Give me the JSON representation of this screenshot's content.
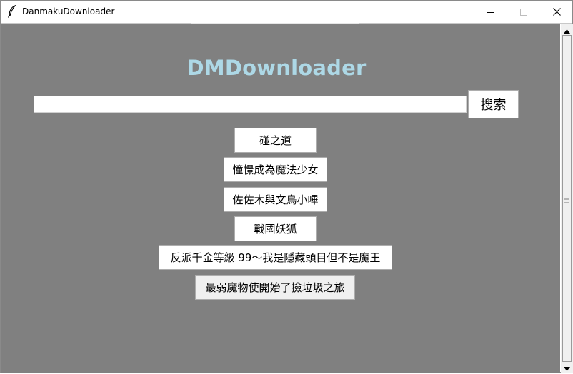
{
  "window": {
    "title": "DanmakuDownloader",
    "icons": [
      "feather-icon",
      "minimize-icon",
      "maximize-icon",
      "close-icon"
    ]
  },
  "main": {
    "heading": "DMDownloader",
    "heading_color": "#add8e6",
    "background_color": "#808080",
    "search": {
      "value": "",
      "placeholder": "",
      "button_label": "搜索"
    },
    "results": [
      {
        "label": "碰之道"
      },
      {
        "label": "憧憬成為魔法少女"
      },
      {
        "label": "佐佐木與文鳥小嗶"
      },
      {
        "label": "戰國妖狐"
      },
      {
        "label": "反派千金等級 99～我是隱藏頭目但不是魔王"
      },
      {
        "label": "最弱魔物使開始了撿垃圾之旅"
      }
    ]
  }
}
